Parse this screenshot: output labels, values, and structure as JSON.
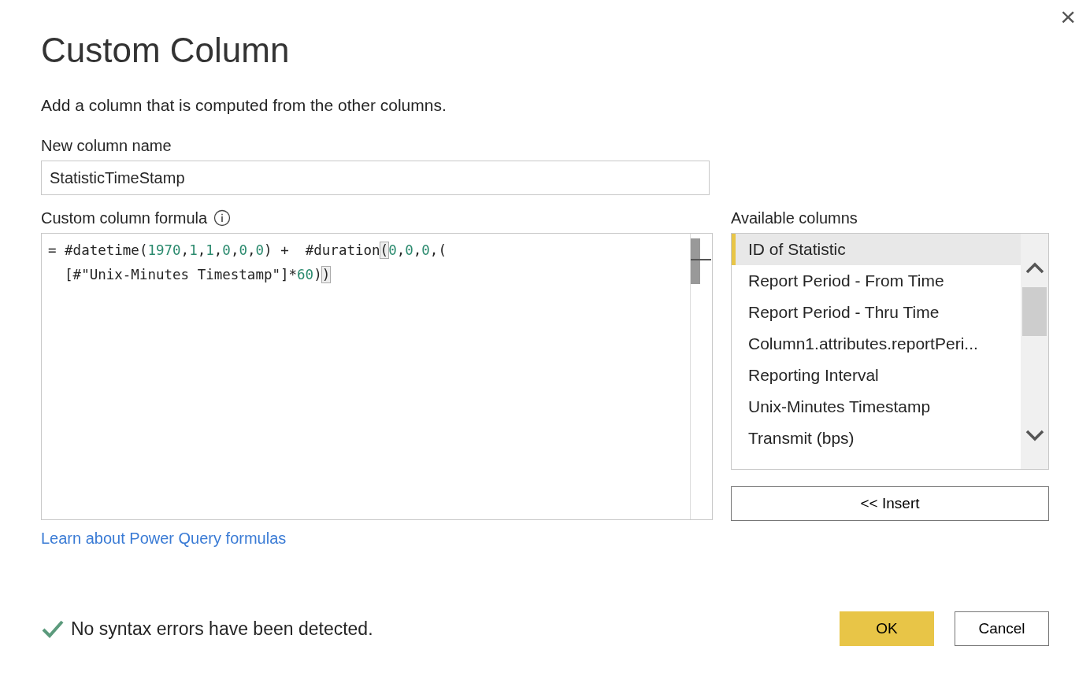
{
  "window": {
    "title": "Custom Column",
    "close": "×"
  },
  "description": "Add a column that is computed from the other columns.",
  "name_field": {
    "label": "New column name",
    "value": "StatisticTimeStamp"
  },
  "formula": {
    "label": "Custom column formula",
    "lines": [
      [
        {
          "kind": "text",
          "text": "= #datetime("
        },
        {
          "kind": "number",
          "text": "1970"
        },
        {
          "kind": "text",
          "text": ","
        },
        {
          "kind": "number",
          "text": "1"
        },
        {
          "kind": "text",
          "text": ","
        },
        {
          "kind": "number",
          "text": "1"
        },
        {
          "kind": "text",
          "text": ","
        },
        {
          "kind": "number",
          "text": "0"
        },
        {
          "kind": "text",
          "text": ","
        },
        {
          "kind": "number",
          "text": "0"
        },
        {
          "kind": "text",
          "text": ","
        },
        {
          "kind": "number",
          "text": "0"
        },
        {
          "kind": "text",
          "text": ") +  #duration"
        },
        {
          "kind": "bracket",
          "text": "("
        },
        {
          "kind": "number",
          "text": "0"
        },
        {
          "kind": "text",
          "text": ","
        },
        {
          "kind": "number",
          "text": "0"
        },
        {
          "kind": "text",
          "text": ","
        },
        {
          "kind": "number",
          "text": "0"
        },
        {
          "kind": "text",
          "text": ",("
        }
      ],
      [
        {
          "kind": "text",
          "text": "  [#\"Unix-Minutes Timestamp\"]*"
        },
        {
          "kind": "number",
          "text": "60"
        },
        {
          "kind": "text",
          "text": ")"
        },
        {
          "kind": "bracket",
          "text": ")"
        }
      ]
    ]
  },
  "learn_link": "Learn about Power Query formulas",
  "available": {
    "label": "Available columns",
    "items": [
      {
        "text": "ID of Statistic",
        "selected": true
      },
      {
        "text": "Report Period - From Time",
        "selected": false
      },
      {
        "text": "Report Period - Thru Time",
        "selected": false
      },
      {
        "text": "Column1.attributes.reportPeri...",
        "selected": false
      },
      {
        "text": "Reporting Interval",
        "selected": false
      },
      {
        "text": "Unix-Minutes Timestamp",
        "selected": false
      },
      {
        "text": "Transmit (bps)",
        "selected": false
      }
    ]
  },
  "insert_button": "<< Insert",
  "status": {
    "kind": "ok",
    "text": "No syntax errors have been detected."
  },
  "buttons": [
    {
      "text": "OK",
      "primary": true
    },
    {
      "text": "Cancel",
      "primary": false
    }
  ]
}
